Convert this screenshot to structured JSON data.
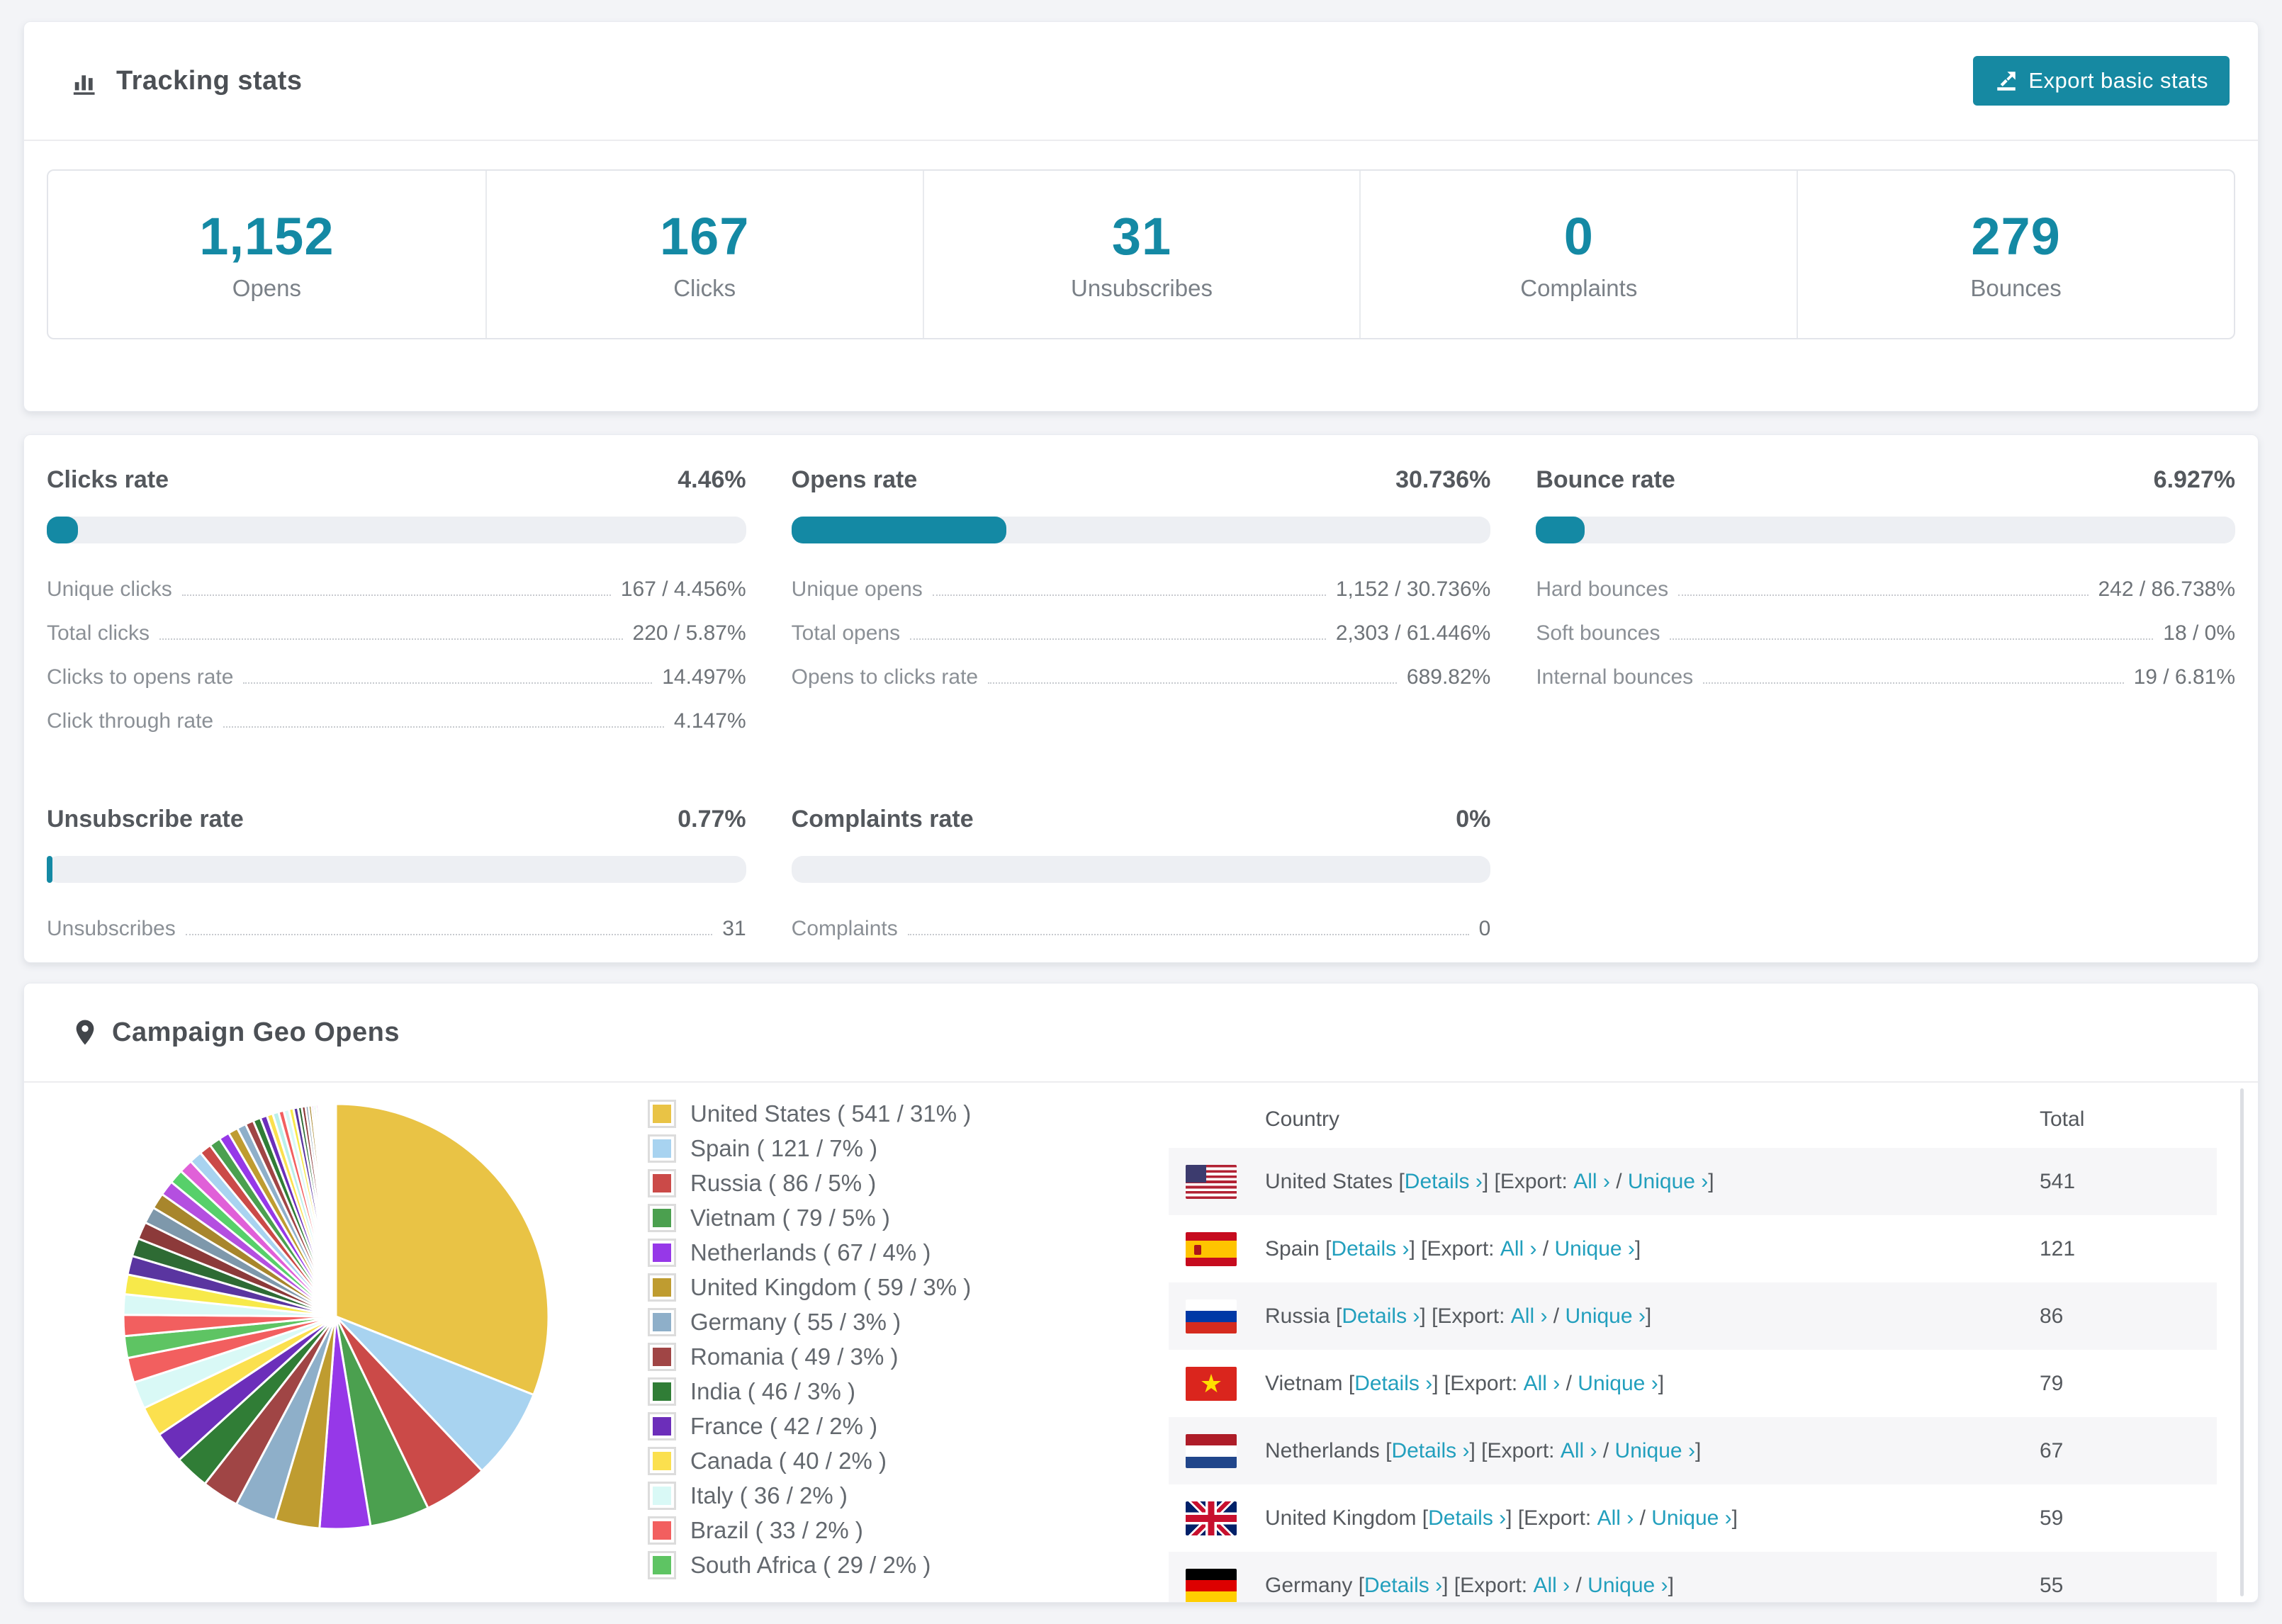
{
  "colors": {
    "accent": "#1489a4",
    "button": "#1689a2",
    "link": "#229fbd",
    "bar_track": "#edeff3",
    "page_background": "#f3f4f7",
    "row_stripe": "#f6f6f8"
  },
  "tracking": {
    "title": "Tracking stats",
    "export_button": "Export basic stats",
    "stats": [
      {
        "value": "1,152",
        "label": "Opens"
      },
      {
        "value": "167",
        "label": "Clicks"
      },
      {
        "value": "31",
        "label": "Unsubscribes"
      },
      {
        "value": "0",
        "label": "Complaints"
      },
      {
        "value": "279",
        "label": "Bounces"
      }
    ]
  },
  "rates": {
    "blocks": [
      {
        "title": "Clicks rate",
        "value": "4.46%",
        "percent": 4.46,
        "lines": [
          {
            "label": "Unique clicks",
            "value": "167 / 4.456%"
          },
          {
            "label": "Total clicks",
            "value": "220 / 5.87%"
          },
          {
            "label": "Clicks to opens rate",
            "value": "14.497%"
          },
          {
            "label": "Click through rate",
            "value": "4.147%"
          }
        ]
      },
      {
        "title": "Opens rate",
        "value": "30.736%",
        "percent": 30.736,
        "lines": [
          {
            "label": "Unique opens",
            "value": "1,152 / 30.736%"
          },
          {
            "label": "Total opens",
            "value": "2,303 / 61.446%"
          },
          {
            "label": "Opens to clicks rate",
            "value": "689.82%"
          }
        ]
      },
      {
        "title": "Bounce rate",
        "value": "6.927%",
        "percent": 6.927,
        "lines": [
          {
            "label": "Hard bounces",
            "value": "242 / 86.738%"
          },
          {
            "label": "Soft bounces",
            "value": "18 / 0%"
          },
          {
            "label": "Internal bounces",
            "value": "19 / 6.81%"
          }
        ]
      },
      {
        "title": "Unsubscribe rate",
        "value": "0.77%",
        "percent": 0.77,
        "lines": [
          {
            "label": "Unsubscribes",
            "value": "31"
          }
        ]
      },
      {
        "title": "Complaints rate",
        "value": "0%",
        "percent": 0,
        "lines": [
          {
            "label": "Complaints",
            "value": "0"
          }
        ]
      }
    ]
  },
  "geo": {
    "title": "Campaign Geo Opens",
    "table": {
      "col_country": "Country",
      "col_total": "Total",
      "details_label": "Details ›",
      "bracket_open": " [",
      "bracket_close": "] ",
      "export_prefix": "[Export: ",
      "all_label": "All ›",
      "separator": " / ",
      "unique_label": "Unique ›",
      "suffix": "]",
      "rows": [
        {
          "country": "United States",
          "flag": "us",
          "total": "541"
        },
        {
          "country": "Spain",
          "flag": "es",
          "total": "121"
        },
        {
          "country": "Russia",
          "flag": "ru",
          "total": "86"
        },
        {
          "country": "Vietnam",
          "flag": "vn",
          "total": "79"
        },
        {
          "country": "Netherlands",
          "flag": "nl",
          "total": "67"
        },
        {
          "country": "United Kingdom",
          "flag": "gb",
          "total": "59"
        },
        {
          "country": "Germany",
          "flag": "de",
          "total": "55"
        }
      ]
    }
  },
  "chart_data": {
    "type": "pie",
    "title": "Campaign Geo Opens",
    "legend_position": "right",
    "start_angle_deg": -90,
    "direction": "clockwise",
    "slices": [
      {
        "label": "United States",
        "value": 541,
        "pct": "31%",
        "color": "#e9c345",
        "legend": "United States ( 541 / 31% )"
      },
      {
        "label": "Spain",
        "value": 121,
        "pct": "7%",
        "color": "#a8d3f0",
        "legend": "Spain ( 121 / 7% )"
      },
      {
        "label": "Russia",
        "value": 86,
        "pct": "5%",
        "color": "#cb4a48",
        "legend": "Russia ( 86 / 5% )"
      },
      {
        "label": "Vietnam",
        "value": 79,
        "pct": "5%",
        "color": "#4ba04f",
        "legend": "Vietnam ( 79 / 5% )"
      },
      {
        "label": "Netherlands",
        "value": 67,
        "pct": "4%",
        "color": "#9638e8",
        "legend": "Netherlands ( 67 / 4% )"
      },
      {
        "label": "United Kingdom",
        "value": 59,
        "pct": "3%",
        "color": "#bf9c30",
        "legend": "United Kingdom ( 59 / 3% )"
      },
      {
        "label": "Germany",
        "value": 55,
        "pct": "3%",
        "color": "#8eafc9",
        "legend": "Germany ( 55 / 3% )"
      },
      {
        "label": "Romania",
        "value": 49,
        "pct": "3%",
        "color": "#a04545",
        "legend": "Romania ( 49 / 3% )"
      },
      {
        "label": "India",
        "value": 46,
        "pct": "3%",
        "color": "#307d36",
        "legend": "India ( 46 / 3% )"
      },
      {
        "label": "France",
        "value": 42,
        "pct": "2%",
        "color": "#6c2eba",
        "legend": "France ( 42 / 2% )"
      },
      {
        "label": "Canada",
        "value": 40,
        "pct": "2%",
        "color": "#fbe04e",
        "legend": "Canada ( 40 / 2% )"
      },
      {
        "label": "Italy",
        "value": 36,
        "pct": "2%",
        "color": "#d9f9f6",
        "legend": "Italy ( 36 / 2% )"
      },
      {
        "label": "Brazil",
        "value": 33,
        "pct": "2%",
        "color": "#f25f5f",
        "legend": "Brazil ( 33 / 2% )"
      },
      {
        "label": "South Africa",
        "value": 29,
        "pct": "2%",
        "color": "#5ec463",
        "legend": "South Africa ( 29 / 2% )"
      }
    ],
    "others_values": [
      28,
      27,
      26,
      25,
      24,
      23,
      22,
      21,
      20,
      19,
      18,
      17,
      16,
      15,
      14,
      13,
      12,
      11,
      10,
      9,
      8,
      8,
      7,
      7,
      6,
      6,
      5,
      5,
      4,
      4,
      3,
      3,
      3,
      2,
      2,
      2,
      2,
      1,
      1,
      1,
      1,
      1,
      1,
      1,
      1,
      1,
      1,
      1,
      1,
      1,
      1,
      1
    ],
    "others_palette": [
      "#f25f5f",
      "#d9f9f6",
      "#f7e94a",
      "#5a35a0",
      "#2e6b34",
      "#8c3a3a",
      "#7e98ab",
      "#a8862c",
      "#b44fe0",
      "#57d06a",
      "#e060d8",
      "#a8d3f0",
      "#cb4a48",
      "#4ba04f",
      "#9638e8",
      "#bf9c30",
      "#8eafc9",
      "#a04545",
      "#307d36",
      "#6c2eba",
      "#fbe04e",
      "#baf0ea"
    ]
  }
}
